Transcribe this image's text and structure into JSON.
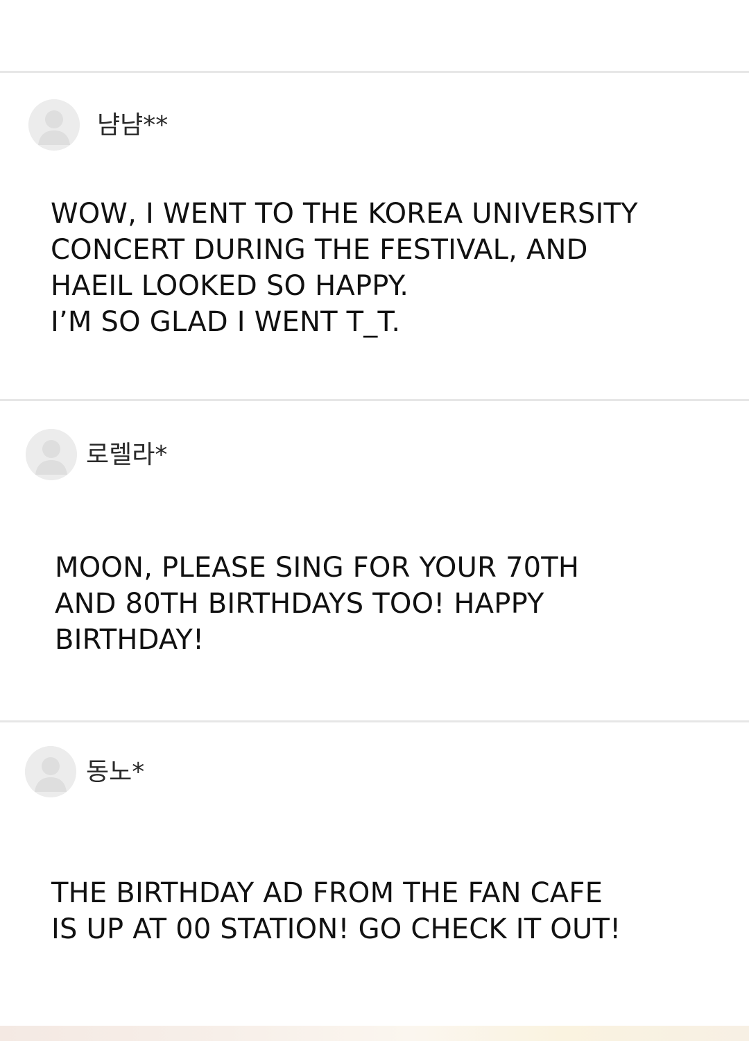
{
  "comments": [
    {
      "username": "냠냠**",
      "text": "WOW, I WENT TO THE KOREA UNIVERSITY\nCONCERT DURING THE FESTIVAL, AND\nHAEIL LOOKED SO HAPPY.\nI’M SO GLAD I WENT T_T.",
      "avatar_icon": "user-avatar-icon"
    },
    {
      "username": "로렐라*",
      "text": "MOON, PLEASE SING FOR YOUR 70TH\nAND 80TH BIRTHDAYS TOO! HAPPY\nBIRTHDAY!",
      "avatar_icon": "user-avatar-icon"
    },
    {
      "username": "동노*",
      "text": "THE BIRTHDAY AD FROM THE FAN CAFE\nIS UP AT 00 STATION! GO CHECK IT OUT!",
      "avatar_icon": "user-avatar-icon"
    }
  ],
  "colors": {
    "background": "#ffffff",
    "divider": "#e6e6e6",
    "avatar_bg": "#ececec",
    "avatar_figure": "#dedede",
    "text": "#111111"
  }
}
